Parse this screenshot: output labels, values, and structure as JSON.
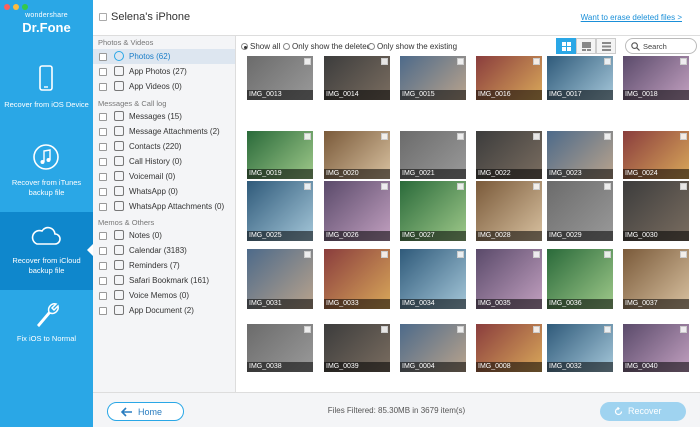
{
  "brand": {
    "top": "wondershare",
    "main": "Dr.Fone"
  },
  "nav": [
    {
      "label": "Recover from iOS Device",
      "icon": "phone-icon"
    },
    {
      "label": "Recover from iTunes backup file",
      "icon": "music-note-icon"
    },
    {
      "label": "Recover from iCloud backup file",
      "icon": "cloud-icon",
      "active": true
    },
    {
      "label": "Fix iOS to Normal",
      "icon": "wrench-icon"
    }
  ],
  "header": {
    "device_name": "Selena's iPhone",
    "erase_link": "Want to erase deleted files >"
  },
  "categories": {
    "photos_videos": {
      "heading": "Photos & Videos",
      "items": [
        {
          "label": "Photos (62)",
          "active": true
        },
        {
          "label": "App Photos (27)"
        },
        {
          "label": "App Videos (0)"
        }
      ]
    },
    "messages_calllog": {
      "heading": "Messages & Call log",
      "items": [
        {
          "label": "Messages (15)"
        },
        {
          "label": "Message Attachments (2)"
        },
        {
          "label": "Contacts (220)"
        },
        {
          "label": "Call History (0)"
        },
        {
          "label": "Voicemail (0)"
        },
        {
          "label": "WhatsApp (0)"
        },
        {
          "label": "WhatsApp Attachments (0)"
        }
      ]
    },
    "memos_others": {
      "heading": "Memos & Others",
      "items": [
        {
          "label": "Notes (0)"
        },
        {
          "label": "Calendar (3183)"
        },
        {
          "label": "Reminders (7)"
        },
        {
          "label": "Safari Bookmark (161)"
        },
        {
          "label": "Voice Memos (0)"
        },
        {
          "label": "App Document (2)"
        }
      ]
    }
  },
  "filter": {
    "show_all": "Show all",
    "only_deleted": "Only show the deleted",
    "only_existing": "Only show the existing",
    "selected": "show_all"
  },
  "search": {
    "placeholder": "Search"
  },
  "photos": [
    [
      "IMG_0013",
      "IMG_0014",
      "IMG_0015",
      "IMG_0016",
      "IMG_0017",
      "IMG_0018"
    ],
    [
      "IMG_0019",
      "IMG_0020",
      "IMG_0021",
      "IMG_0022",
      "IMG_0023",
      "IMG_0024"
    ],
    [
      "IMG_0025",
      "IMG_0026",
      "IMG_0027",
      "IMG_0028",
      "IMG_0029",
      "IMG_0030"
    ],
    [
      "IMG_0031",
      "IMG_0033",
      "IMG_0034",
      "IMG_0035",
      "IMG_0036",
      "IMG_0037"
    ],
    [
      "IMG_0038",
      "IMG_0039",
      "IMG_0004",
      "IMG_0008",
      "IMG_0032",
      "IMG_0040"
    ]
  ],
  "footer": {
    "home_label": "Home",
    "filtered_text": "Files Filtered: 85.30MB in 3679 item(s)",
    "recover_label": "Recover"
  },
  "colors": {
    "sidebar": "#2aa7e6",
    "sidebar_active": "#0f87cc",
    "accent": "#1a8fd8"
  }
}
